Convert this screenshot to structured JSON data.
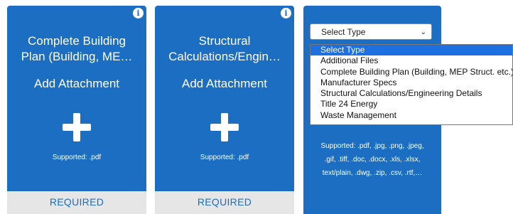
{
  "cards": [
    {
      "title_line1": "Complete Building",
      "title_line2": "Plan (Building, ME…",
      "add_label": "Add Attachment",
      "supported": "Supported: .pdf",
      "required": "REQUIRED"
    },
    {
      "title_line1": "Structural",
      "title_line2": "Calculations/Engin…",
      "add_label": "Add Attachment",
      "supported": "Supported: .pdf",
      "required": "REQUIRED"
    }
  ],
  "type_card": {
    "select_value": "Select Type",
    "supported_line1": "Supported: .pdf, .jpg, .png, .jpeg,",
    "supported_line2": ".gif, .tiff, .doc, .docx, .xls, .xlsx,",
    "supported_line3": "text/plain, .dwg, .zip, .csv, .rtf,…"
  },
  "dropdown": {
    "options": [
      "Select Type",
      "Additional Files",
      "Complete Building Plan (Building, MEP Struct. etc.)",
      "Manufacturer Specs",
      "Structural Calculations/Engineering Details",
      "Title 24 Energy",
      "Waste Management"
    ],
    "selected_index": 0
  },
  "colors": {
    "card_blue": "#1b6ec2",
    "required_bar": "#e6e6e6",
    "selected_option": "#1e6fe0"
  },
  "icons": [
    "info-icon",
    "plus-icon",
    "chevron-down-icon"
  ]
}
